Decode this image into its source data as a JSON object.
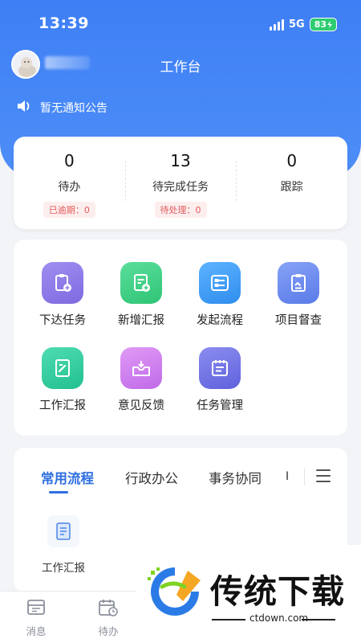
{
  "status_bar": {
    "time": "13:39",
    "network": "5G",
    "battery": "83"
  },
  "header": {
    "title": "工作台",
    "user_name": "***"
  },
  "notice": {
    "text": "暂无通知公告"
  },
  "stats": [
    {
      "value": "0",
      "label": "待办",
      "badge": "已逾期：0"
    },
    {
      "value": "13",
      "label": "待完成任务",
      "badge": "待处理：0"
    },
    {
      "value": "0",
      "label": "跟踪",
      "badge": ""
    }
  ],
  "apps": [
    {
      "label": "下达任务",
      "icon": "clipboard-add-icon",
      "color": "#8f7ce8"
    },
    {
      "label": "新增汇报",
      "icon": "document-add-icon",
      "color": "#3fcf85"
    },
    {
      "label": "发起流程",
      "icon": "flow-icon",
      "color": "#3a9ef5"
    },
    {
      "label": "项目督查",
      "icon": "clipboard-check-icon",
      "color": "#6b8cf0"
    },
    {
      "label": "工作汇报",
      "icon": "document-edit-icon",
      "color": "#34cc9c"
    },
    {
      "label": "意见反馈",
      "icon": "inbox-icon",
      "color": "#cf7ff0"
    },
    {
      "label": "任务管理",
      "icon": "list-icon",
      "color": "#6d6fe6"
    }
  ],
  "flow_tabs": {
    "tabs": [
      "常用流程",
      "行政办公",
      "事务协同"
    ],
    "active": "常用流程",
    "overflow": "I"
  },
  "flow_items": [
    {
      "label": "工作汇报",
      "icon": "document-icon"
    }
  ],
  "tabbar": [
    {
      "label": "消息",
      "icon": "message-icon"
    },
    {
      "label": "待办",
      "icon": "calendar-clock-icon"
    }
  ],
  "watermark": {
    "text": "传统下载",
    "url": "ctdown.com"
  },
  "colors": {
    "primary": "#3e7ff5",
    "accent": "#2f6fe0",
    "danger": "#e25b5b"
  }
}
